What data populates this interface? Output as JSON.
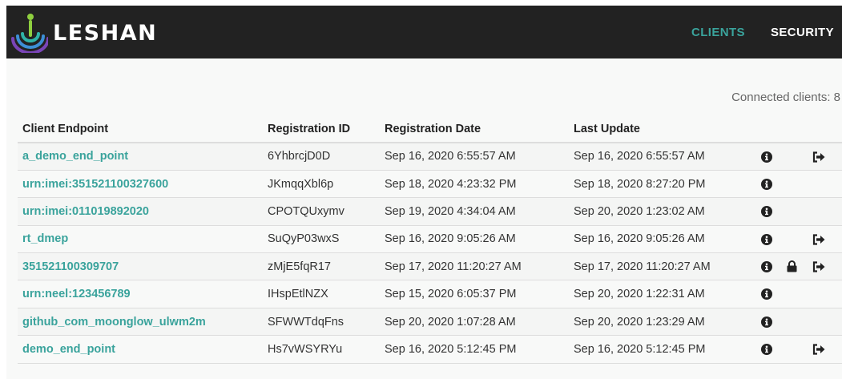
{
  "brand": {
    "name": "LESHAN"
  },
  "nav": {
    "clients": "CLIENTS",
    "security": "SECURITY"
  },
  "colors": {
    "accent": "#3aa39c",
    "navbar": "#222222"
  },
  "summary": "Connected clients: 8",
  "table": {
    "headers": [
      "Client Endpoint",
      "Registration ID",
      "Registration Date",
      "Last Update"
    ],
    "rows": [
      {
        "endpoint": "a_demo_end_point",
        "reg_id": "6YhbrcjD0D",
        "reg_date": "Sep 16, 2020 6:55:57 AM",
        "last_update": "Sep 16, 2020 6:55:57 AM",
        "icons": [
          "info-icon",
          "sign-out-icon"
        ]
      },
      {
        "endpoint": "urn:imei:351521100327600",
        "reg_id": "JKmqqXbl6p",
        "reg_date": "Sep 18, 2020 4:23:32 PM",
        "last_update": "Sep 18, 2020 8:27:20 PM",
        "icons": [
          "info-icon"
        ]
      },
      {
        "endpoint": "urn:imei:011019892020",
        "reg_id": "CPOTQUxymv",
        "reg_date": "Sep 19, 2020 4:34:04 AM",
        "last_update": "Sep 20, 2020 1:23:02 AM",
        "icons": [
          "info-icon"
        ]
      },
      {
        "endpoint": "rt_dmep",
        "reg_id": "SuQyP03wxS",
        "reg_date": "Sep 16, 2020 9:05:26 AM",
        "last_update": "Sep 16, 2020 9:05:26 AM",
        "icons": [
          "info-icon",
          "sign-out-icon"
        ]
      },
      {
        "endpoint": "351521100309707",
        "reg_id": "zMjE5fqR17",
        "reg_date": "Sep 17, 2020 11:20:27 AM",
        "last_update": "Sep 17, 2020 11:20:27 AM",
        "icons": [
          "info-icon",
          "lock-icon",
          "sign-out-icon"
        ]
      },
      {
        "endpoint": "urn:neel:123456789",
        "reg_id": "IHspEtlNZX",
        "reg_date": "Sep 15, 2020 6:05:37 PM",
        "last_update": "Sep 20, 2020 1:22:31 AM",
        "icons": [
          "info-icon"
        ]
      },
      {
        "endpoint": "github_com_moonglow_ulwm2m",
        "reg_id": "SFWWTdqFns",
        "reg_date": "Sep 20, 2020 1:07:28 AM",
        "last_update": "Sep 20, 2020 1:23:29 AM",
        "icons": [
          "info-icon"
        ]
      },
      {
        "endpoint": "demo_end_point",
        "reg_id": "Hs7vWSYRYu",
        "reg_date": "Sep 16, 2020 5:12:45 PM",
        "last_update": "Sep 16, 2020 5:12:45 PM",
        "icons": [
          "info-icon",
          "sign-out-icon"
        ]
      }
    ]
  }
}
